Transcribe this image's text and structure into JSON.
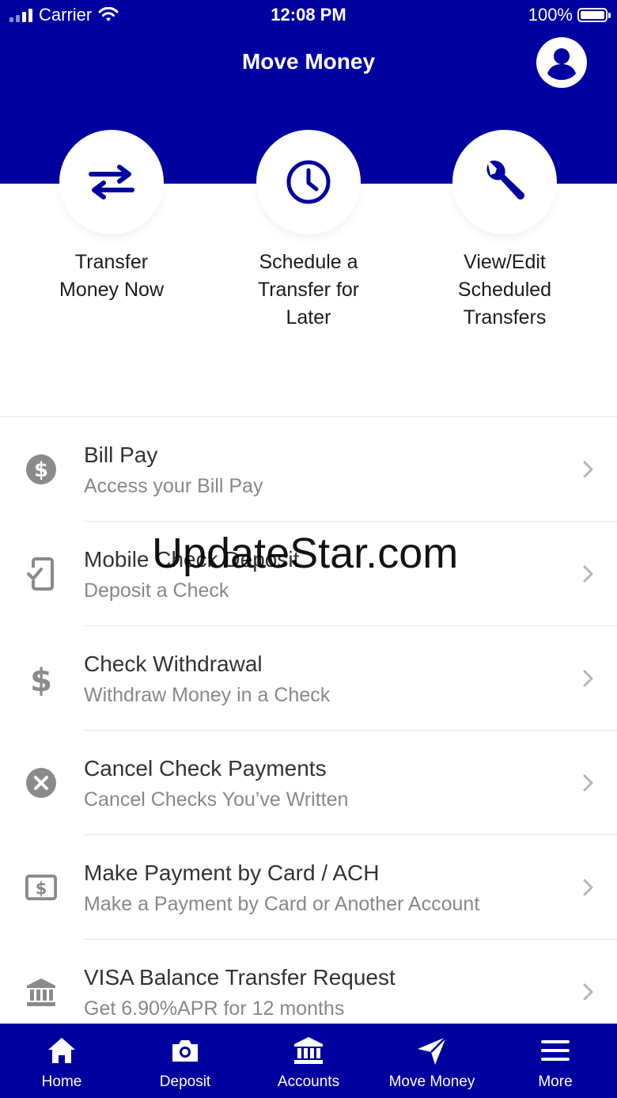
{
  "status_bar": {
    "carrier": "Carrier",
    "time": "12:08 PM",
    "battery": "100%"
  },
  "header": {
    "title": "Move Money"
  },
  "quick_actions": [
    {
      "label": "Transfer Money Now",
      "icon": "transfer-arrows-icon"
    },
    {
      "label": "Schedule a Transfer for Later",
      "icon": "clock-icon"
    },
    {
      "label": "View/Edit Scheduled Transfers",
      "icon": "wrench-icon"
    }
  ],
  "list_items": [
    {
      "title": "Bill Pay",
      "subtitle": "Access your Bill Pay",
      "icon": "dollar-circle-icon"
    },
    {
      "title": "Mobile Check Deposit",
      "subtitle": "Deposit a Check",
      "icon": "phone-check-icon"
    },
    {
      "title": "Check Withdrawal",
      "subtitle": "Withdraw Money in a Check",
      "icon": "dollar-sign-icon"
    },
    {
      "title": "Cancel Check Payments",
      "subtitle": "Cancel Checks You’ve Written",
      "icon": "cancel-circle-icon"
    },
    {
      "title": "Make Payment by Card / ACH",
      "subtitle": "Make a Payment by Card or Another Account",
      "icon": "money-bill-icon"
    },
    {
      "title": "VISA Balance Transfer Request",
      "subtitle": "Get 6.90%APR for 12 months",
      "icon": "bank-icon"
    }
  ],
  "watermark": "UpdateStar.com",
  "tab_bar": [
    {
      "label": "Home",
      "icon": "home-icon"
    },
    {
      "label": "Deposit",
      "icon": "camera-icon"
    },
    {
      "label": "Accounts",
      "icon": "bank-icon"
    },
    {
      "label": "Move Money",
      "icon": "paper-plane-icon",
      "active": true
    },
    {
      "label": "More",
      "icon": "menu-icon"
    }
  ],
  "colors": {
    "brand": "#0000A0",
    "icon_gray": "#8a8a8a"
  }
}
